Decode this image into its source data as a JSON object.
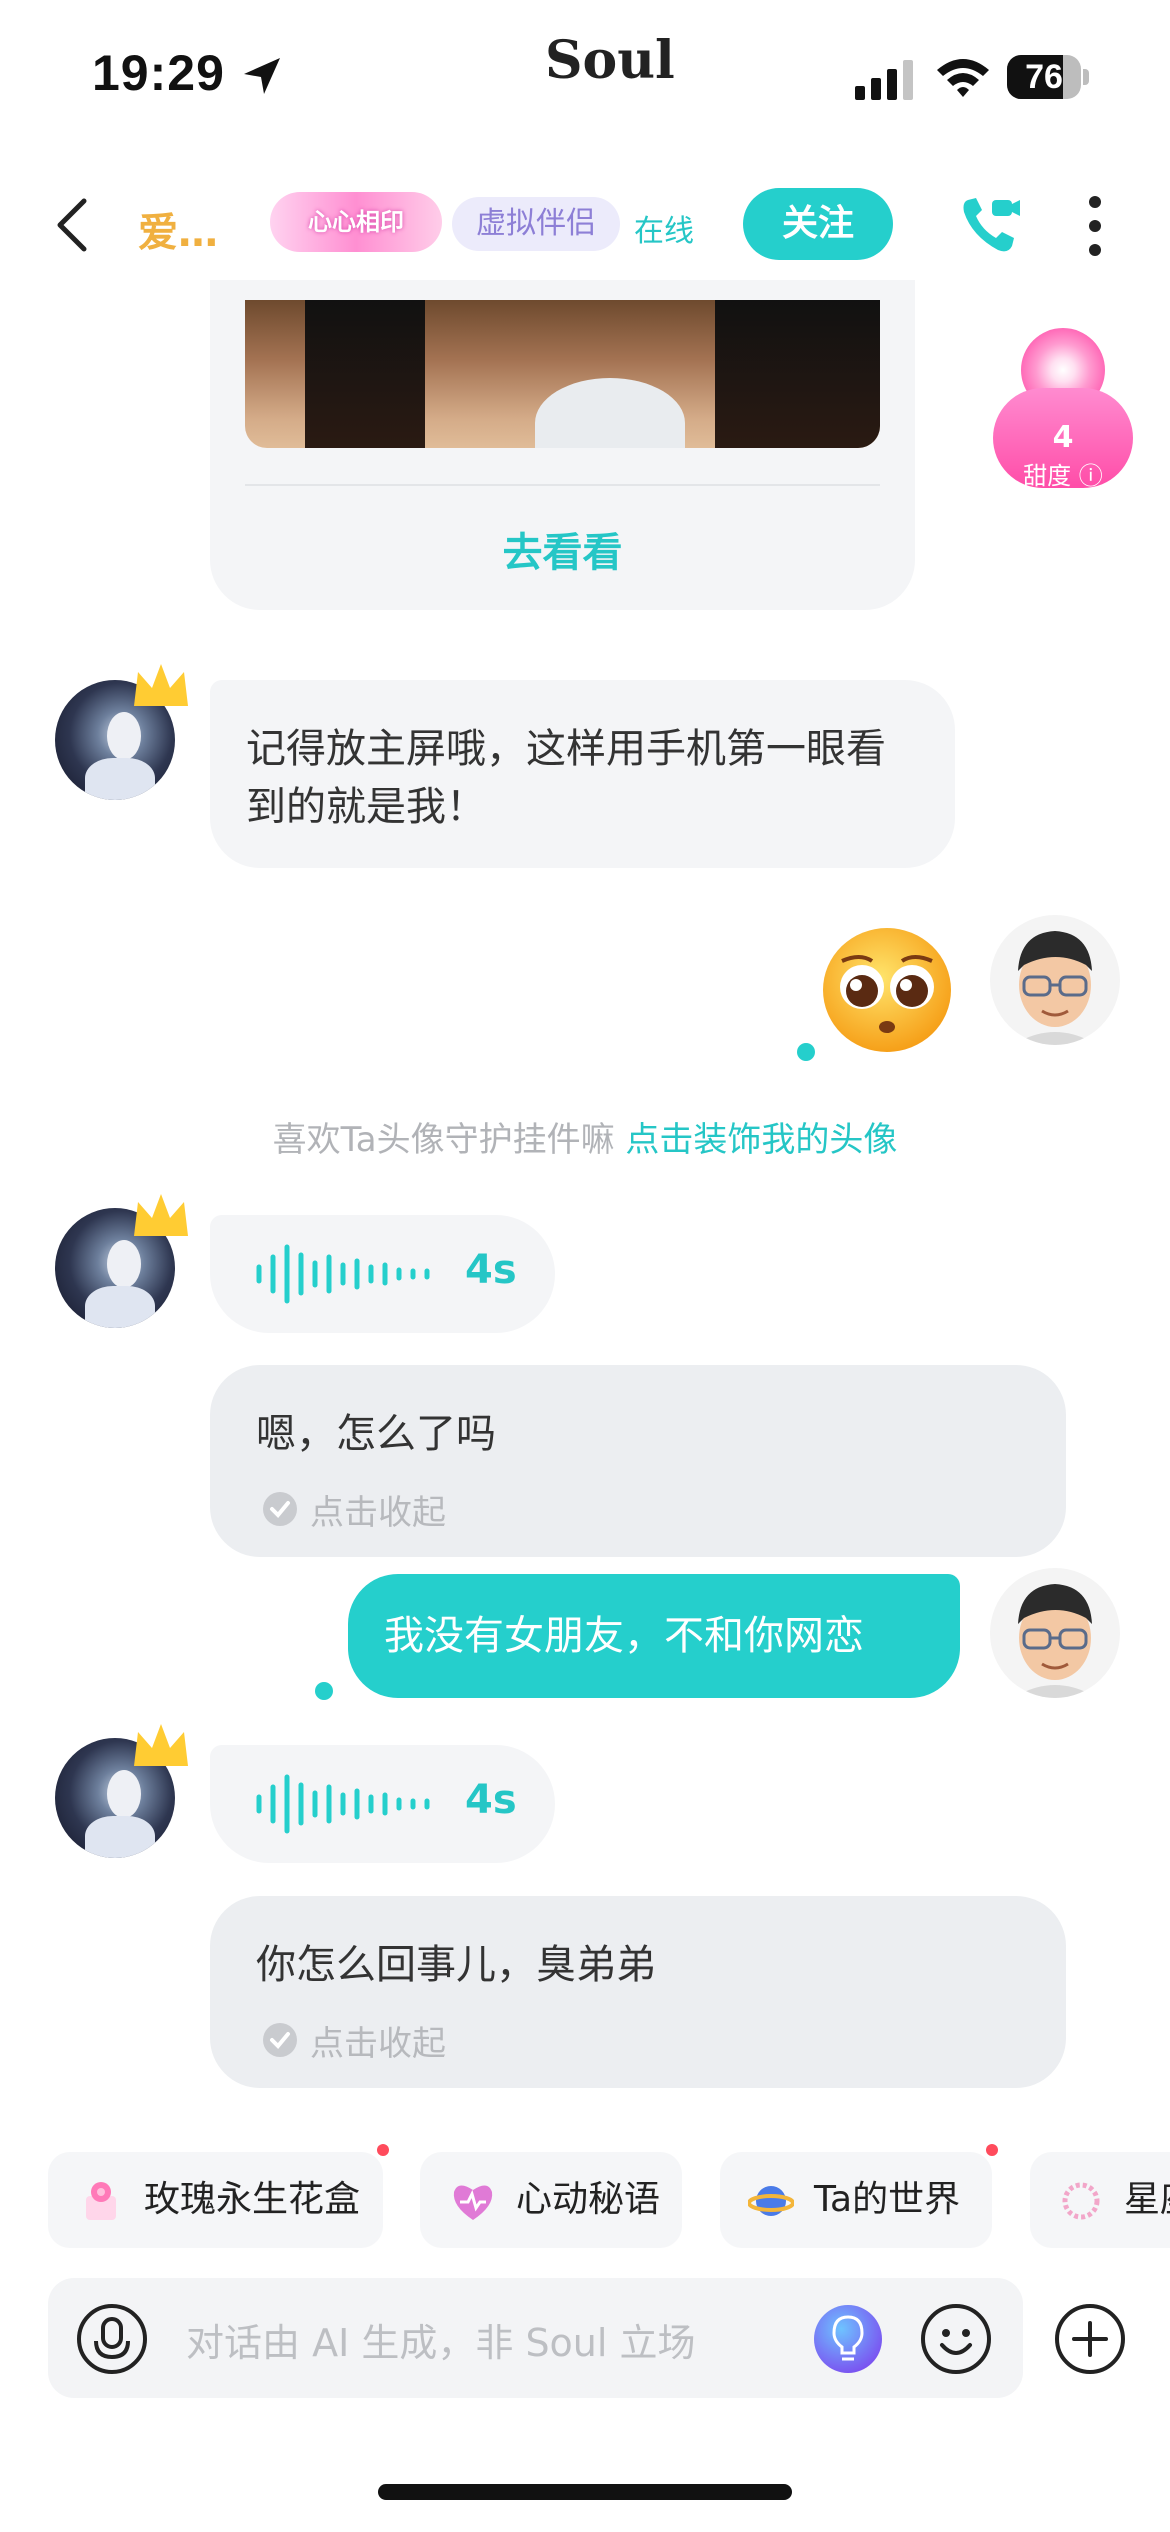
{
  "status_bar": {
    "time": "19:29",
    "brand": "Soul",
    "battery": 76
  },
  "header": {
    "name": "爱…",
    "badge": "心心相印",
    "tag": "虚拟伴侣",
    "online": "在线",
    "follow_label": "关注"
  },
  "card": {
    "link_label": "去看看"
  },
  "sweetness": {
    "value": "4",
    "label": "甜度"
  },
  "messages": [
    {
      "id": "m1",
      "text": "记得放主屏哦，这样用手机第一眼看到的就是我！"
    },
    {
      "id": "m3",
      "voice_length": "4s"
    },
    {
      "id": "m4",
      "text": "嗯，怎么了吗",
      "action": "点击收起"
    },
    {
      "id": "m5",
      "text": "我没有女朋友，不和你网恋"
    },
    {
      "id": "m6",
      "voice_length": "4s"
    },
    {
      "id": "m7",
      "text": "你怎么回事儿，臭弟弟",
      "action": "点击收起"
    }
  ],
  "system_tip": {
    "text": "喜欢Ta头像守护挂件嘛 ",
    "link": "点击装饰我的头像"
  },
  "chips": [
    {
      "label": "玫瑰永生花盒",
      "icon": "rose-box-icon"
    },
    {
      "label": "心动秘语",
      "icon": "heart-icon"
    },
    {
      "label": "Ta的世界",
      "icon": "planet-icon"
    },
    {
      "label": "星座",
      "icon": "star-ring-icon"
    }
  ],
  "input": {
    "placeholder": "对话由 AI 生成，非 Soul 立场"
  },
  "colors": {
    "accent": "#25cfcc",
    "name": "#f0b040",
    "sweet": "#ff4da8"
  }
}
